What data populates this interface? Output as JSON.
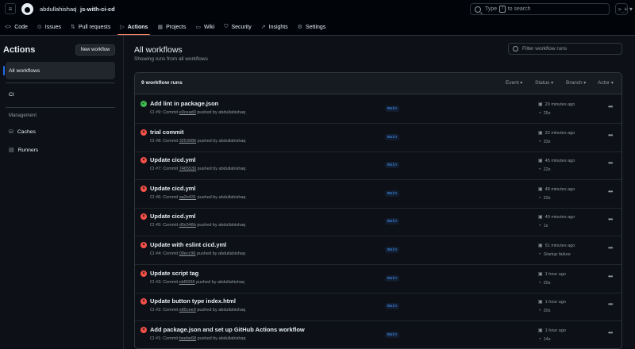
{
  "header": {
    "owner": "abdullahishaq",
    "separator": "/",
    "repo": "js-with-ci-cd",
    "search_prefix": "Type",
    "search_key": "/",
    "search_suffix": "to search",
    "cmd_label": ">_",
    "plus_label": "+ ▾",
    "menu_icon": "≡"
  },
  "tabs": [
    {
      "icon": "<>",
      "label": "Code"
    },
    {
      "icon": "⊙",
      "label": "Issues"
    },
    {
      "icon": "⇅",
      "label": "Pull requests"
    },
    {
      "icon": "▷",
      "label": "Actions"
    },
    {
      "icon": "▦",
      "label": "Projects"
    },
    {
      "icon": "▭",
      "label": "Wiki"
    },
    {
      "icon": "⛉",
      "label": "Security"
    },
    {
      "icon": "↗",
      "label": "Insights"
    },
    {
      "icon": "⚙",
      "label": "Settings"
    }
  ],
  "sidebar": {
    "title": "Actions",
    "new_workflow": "New workflow",
    "all_workflows": "All workflows",
    "ci": "CI",
    "management_label": "Management",
    "caches": "Caches",
    "runners": "Runners"
  },
  "main": {
    "title": "All workflows",
    "subtitle": "Showing runs from all workflows",
    "filter_placeholder": "Filter workflow runs",
    "count_label": "9 workflow runs",
    "filters": [
      "Event",
      "Status",
      "Branch",
      "Actor"
    ]
  },
  "runs": [
    {
      "status": "success",
      "title": "Add lint in package.json",
      "run": "CI #9: Commit",
      "sha": "e9cead0",
      "pushed": "pushed by abdullahishaq",
      "branch": "main",
      "time": "20 minutes ago",
      "duration": "25s"
    },
    {
      "status": "failure",
      "title": "trial commit",
      "run": "CI #8: Commit",
      "sha": "3253086",
      "pushed": "pushed by abdullahishaq",
      "branch": "main",
      "time": "22 minutes ago",
      "duration": "33s"
    },
    {
      "status": "failure",
      "title": "Update cicd.yml",
      "run": "CI #7: Commit",
      "sha": "7465530",
      "pushed": "pushed by abdullahishaq",
      "branch": "main",
      "time": "45 minutes ago",
      "duration": "22s"
    },
    {
      "status": "failure",
      "title": "Update cicd.yml",
      "run": "CI #6: Commit",
      "sha": "aa2e431",
      "pushed": "pushed by abdullahishaq",
      "branch": "main",
      "time": "48 minutes ago",
      "duration": "23s"
    },
    {
      "status": "failure",
      "title": "Update cicd.yml",
      "run": "CI #5: Commit",
      "sha": "d5c048b",
      "pushed": "pushed by abdullahishaq",
      "branch": "main",
      "time": "49 minutes ago",
      "duration": "1s"
    },
    {
      "status": "failure",
      "title": "Update with eslint cicd.yml",
      "run": "CI #4: Commit",
      "sha": "09ecc96",
      "pushed": "pushed by abdullahishaq",
      "branch": "main",
      "time": "51 minutes ago",
      "duration": "Startup failure"
    },
    {
      "status": "failure",
      "title": "Update script tag",
      "run": "CI #3: Commit",
      "sha": "ebf5065",
      "pushed": "pushed by abdullahishaq",
      "branch": "main",
      "time": "1 hour ago",
      "duration": "20s"
    },
    {
      "status": "failure",
      "title": "Update button type index.html",
      "run": "CI #2: Commit",
      "sha": "e85cee0",
      "pushed": "pushed by abdullahishaq",
      "branch": "main",
      "time": "1 hour ago",
      "duration": "20s"
    },
    {
      "status": "failure",
      "title": "Add package.json and set up GitHub Actions workflow",
      "run": "CI #1: Commit",
      "sha": "beebe68",
      "pushed": "pushed by abdullahishaq",
      "branch": "main",
      "time": "1 hour ago",
      "duration": "14s"
    }
  ],
  "colors": {
    "success": "#3fb950",
    "failure": "#f85149",
    "accent": "#f78166",
    "link": "#4493f8"
  }
}
